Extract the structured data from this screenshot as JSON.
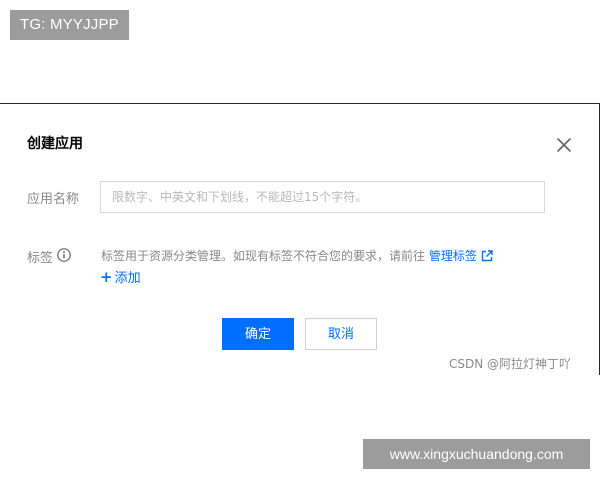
{
  "watermarks": {
    "top_left": "TG: MYYJJPP",
    "csdn": "CSDN @阿拉灯神丁吖",
    "site": "www.xingxuchuandong.com"
  },
  "dialog": {
    "title": "创建应用",
    "close_icon": "close-icon",
    "name_field": {
      "label": "应用名称",
      "value": "",
      "placeholder": "限数字、中英文和下划线，不能超过15个字符。"
    },
    "tag_field": {
      "label": "标签",
      "info_icon": "info-icon",
      "description": "标签用于资源分类管理。如现有标签不符合您的要求，请前往",
      "manage_link": "管理标签",
      "external_icon": "external-link-icon",
      "add_label": "添加",
      "add_icon": "plus-icon"
    },
    "buttons": {
      "confirm": "确定",
      "cancel": "取消"
    }
  },
  "colors": {
    "accent": "#006eff",
    "label": "#888888",
    "border": "#d9d9d9",
    "badge_bg": "#9c9c9c"
  }
}
